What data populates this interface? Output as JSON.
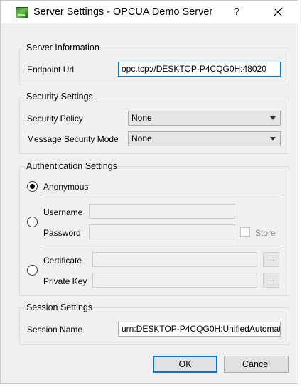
{
  "window": {
    "title": "Server Settings - OPCUA Demo Server",
    "help_label": "?",
    "close_icon": "close-icon",
    "app_icon": "opcua-app-icon"
  },
  "server_info": {
    "group_title": "Server Information",
    "endpoint_label": "Endpoint Url",
    "endpoint_value": "opc.tcp://DESKTOP-P4CQG0H:48020"
  },
  "security": {
    "group_title": "Security Settings",
    "policy_label": "Security Policy",
    "policy_value": "None",
    "mode_label": "Message Security Mode",
    "mode_value": "None"
  },
  "auth": {
    "group_title": "Authentication Settings",
    "anonymous_label": "Anonymous",
    "anonymous_selected": true,
    "username_label": "Username",
    "username_value": "",
    "password_label": "Password",
    "password_value": "",
    "store_label": "Store",
    "certificate_label": "Certificate",
    "certificate_value": "",
    "private_key_label": "Private Key",
    "private_key_value": "",
    "browse_label": "..."
  },
  "session": {
    "group_title": "Session Settings",
    "name_label": "Session Name",
    "name_value": "urn:DESKTOP-P4CQG0H:UnifiedAutomat"
  },
  "buttons": {
    "ok_label": "OK",
    "cancel_label": "Cancel"
  }
}
